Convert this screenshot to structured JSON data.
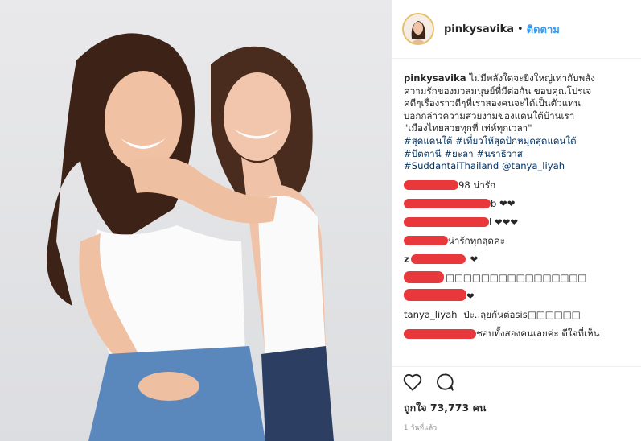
{
  "header": {
    "username": "pinkysavika",
    "dot": "•",
    "follow_label": "ติดตาม"
  },
  "caption": {
    "username": "pinkysavika",
    "lines": [
      "ไม่มีพลังใดจะยิ่งใหญ่เท่ากับพลัง",
      "ความรักของมวลมนุษย์ที่มีต่อกัน ขอบคุณโปรเจ",
      "คดีๆเรื่องราวดีๆที่เราสองคนจะได้เป็นตัวแทน",
      "บอกกล่าวความสวยงามของแดนใต้บ้านเรา",
      "\"เมืองไทยสวยทุกที่ เท่ห์ทุกเวลา\""
    ],
    "tags_line1": [
      "#สุดแดนใต้",
      "#เที่ยวให้สุดปักหมุดสุดแดนใต้"
    ],
    "tags_line2": [
      "#ปัตตานี",
      "#ยะลา",
      "#นราธิวาส"
    ],
    "tags_line3": "#SuddantaiThailand",
    "mention": "@tanya_liyah"
  },
  "comments": [
    {
      "user": "",
      "text": "98 น่ารัก"
    },
    {
      "user": "",
      "text": "b ❤❤"
    },
    {
      "user": "",
      "text": "l ❤❤❤"
    },
    {
      "user": "",
      "text": "น่ารักทุกสุดคะ"
    },
    {
      "user": "z",
      "text": "❤"
    },
    {
      "user": "",
      "text": "□□□□□□□□□□□□□□□□"
    },
    {
      "user": "",
      "text": "❤"
    },
    {
      "user": "tanya_liyah",
      "text": "ป่ะ..ลุยกันต่อsis□□□□□□"
    },
    {
      "user": "",
      "text": "ชอบทั้งสองคนเลยค่ะ ดีใจที่เห็น"
    }
  ],
  "actions": {
    "like_icon": "heart-icon",
    "comment_icon": "comment-icon"
  },
  "likes_text": "ถูกใจ 73,773 คน",
  "timestamp": "1 วันที่แล้ว",
  "colors": {
    "link": "#003569",
    "follow": "#3897f0",
    "redaction": "#e8383c"
  }
}
